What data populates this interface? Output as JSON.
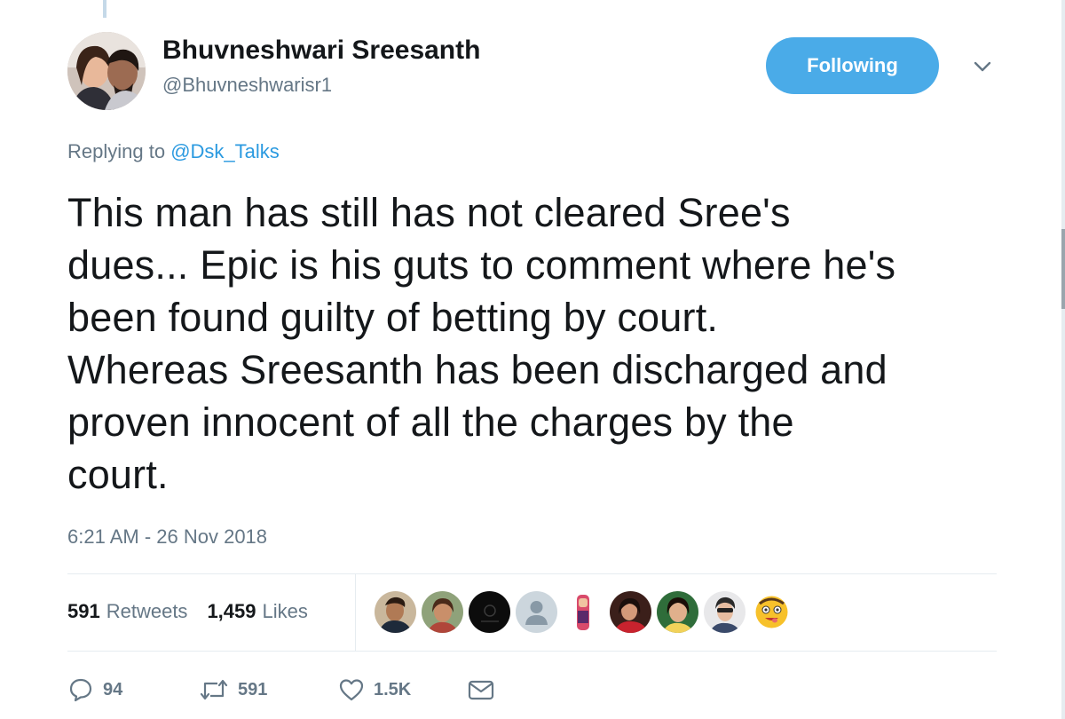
{
  "author": {
    "display_name": "Bhuvneshwari Sreesanth",
    "handle": "@Bhuvneshwarisr1"
  },
  "follow_button": {
    "label": "Following",
    "color": "#4aabe8"
  },
  "menu": {
    "icon": "chevron-down-icon"
  },
  "reply": {
    "prefix": "Replying to ",
    "mention": "@Dsk_Talks"
  },
  "tweet": {
    "lines": [
      "This man has still has not cleared Sree's",
      "dues... Epic is his guts to comment where he's",
      "been found guilty of betting by court.",
      "Whereas Sreesanth has been discharged and",
      "proven innocent of all the charges by the",
      "court."
    ],
    "timestamp": "6:21 AM - 26 Nov 2018"
  },
  "stats": {
    "retweets_count": "591",
    "retweets_label": "Retweets",
    "likes_count": "1,459",
    "likes_label": "Likes"
  },
  "likers": [
    {
      "icon": "liker-avatar-1"
    },
    {
      "icon": "liker-avatar-2"
    },
    {
      "icon": "liker-avatar-3"
    },
    {
      "icon": "default-profile-icon"
    },
    {
      "icon": "liker-avatar-5"
    },
    {
      "icon": "liker-avatar-6"
    },
    {
      "icon": "liker-avatar-7"
    },
    {
      "icon": "liker-avatar-8"
    },
    {
      "icon": "emoji-avatar-icon"
    }
  ],
  "actions": {
    "reply": {
      "icon": "reply-icon",
      "count": "94"
    },
    "retweet": {
      "icon": "retweet-icon",
      "count": "591"
    },
    "like": {
      "icon": "heart-icon",
      "count": "1.5K"
    },
    "message": {
      "icon": "envelope-icon"
    }
  },
  "colors": {
    "text_primary": "#14171a",
    "text_secondary": "#657786",
    "link": "#2b9ae0",
    "divider": "#e6ecf0"
  }
}
